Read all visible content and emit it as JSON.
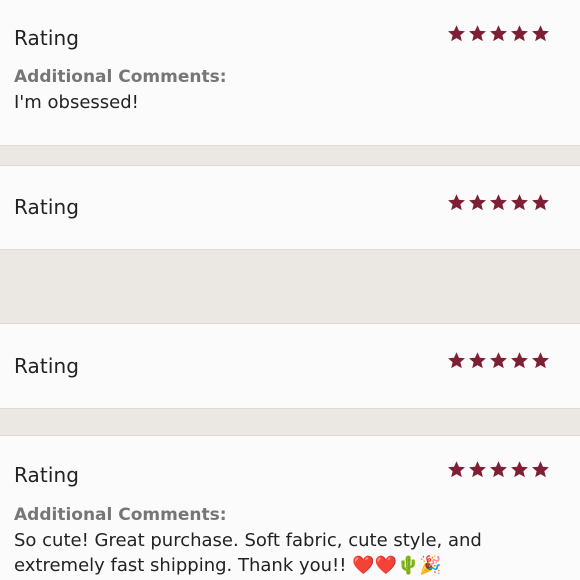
{
  "colors": {
    "star": "#7e2035",
    "card_bg": "#fcfbfb",
    "separator_bg": "#ebe8e4",
    "label_grey": "#767676",
    "text": "#222222"
  },
  "reviews": [
    {
      "rating_label": "Rating",
      "stars": 5,
      "comments_label": "Additional Comments:",
      "comment": "I'm obsessed!"
    },
    {
      "rating_label": "Rating",
      "stars": 5
    },
    {
      "rating_label": "Rating",
      "stars": 5
    },
    {
      "rating_label": "Rating",
      "stars": 5,
      "comments_label": "Additional Comments:",
      "comment": "So cute! Great purchase. Soft fabric, cute style, and extremely fast shipping. Thank you!! ❤️❤️🌵🎉"
    }
  ],
  "icons": [
    "star-icon"
  ]
}
